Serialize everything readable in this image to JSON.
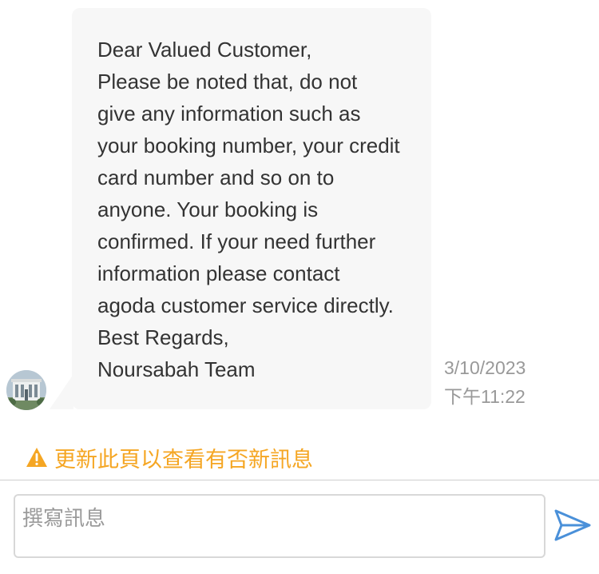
{
  "message": {
    "lines": [
      "Dear Valued Customer,",
      "Please be noted that, do not",
      "give any information such as",
      "your booking number, your credit",
      "card number and so on to",
      "anyone. Your booking is",
      "confirmed. If your need further",
      "information please contact",
      "agoda customer service directly.",
      "Best Regards,",
      "Noursabah Team"
    ],
    "date": "3/10/2023",
    "time": "下午11:22"
  },
  "notice": {
    "text": "更新此頁以查看有否新訊息",
    "icon": "warning-icon",
    "color": "#f5a623"
  },
  "composer": {
    "placeholder": "撰寫訊息",
    "send_icon": "send-icon"
  },
  "colors": {
    "bubble": "#f7f7f7",
    "accent": "#4a90d9",
    "warning": "#f5a623"
  }
}
